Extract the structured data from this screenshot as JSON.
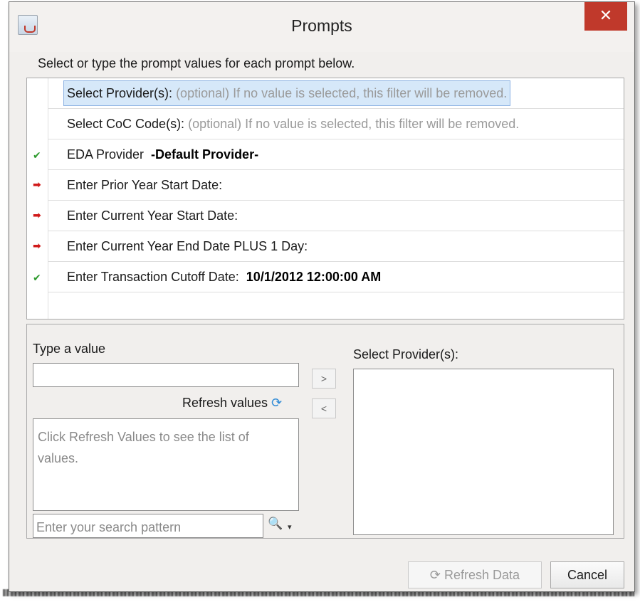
{
  "window": {
    "title": "Prompts",
    "close_glyph": "✕",
    "app_icon": "java-cup-icon"
  },
  "instructions": "Select or type the prompt values for each prompt below.",
  "prompts": [
    {
      "label": "Select Provider(s):",
      "hint": "(optional) If no value is selected, this filter will be removed.",
      "value": "",
      "status": "none",
      "selected": true
    },
    {
      "label": "Select CoC Code(s):",
      "hint": "(optional) If no value is selected, this filter will be removed.",
      "value": "",
      "status": "none",
      "selected": false
    },
    {
      "label": "EDA Provider",
      "hint": "",
      "value": "-Default Provider-",
      "status": "check",
      "selected": false
    },
    {
      "label": "Enter Prior Year Start Date:",
      "hint": "",
      "value": "",
      "status": "arrow",
      "selected": false
    },
    {
      "label": "Enter Current Year Start Date:",
      "hint": "",
      "value": "",
      "status": "arrow",
      "selected": false
    },
    {
      "label": "Enter Current Year End Date PLUS 1 Day:",
      "hint": "",
      "value": "",
      "status": "arrow",
      "selected": false
    },
    {
      "label": "Enter Transaction Cutoff Date:",
      "hint": "",
      "value": "10/1/2012 12:00:00 AM",
      "status": "check",
      "selected": false
    }
  ],
  "status_glyphs": {
    "check": "✔",
    "arrow": "➡"
  },
  "value_panel": {
    "type_label": "Type a value",
    "type_value": "",
    "refresh_values_label": "Refresh values",
    "refresh_glyph": "⟳",
    "list_placeholder": "Click Refresh Values to see the list of values.",
    "search_placeholder": "Enter your search pattern",
    "search_icon_glyph": "🔍",
    "dropdown_glyph": "▾",
    "add_glyph": ">",
    "remove_glyph": "<",
    "selected_label": "Select Provider(s):"
  },
  "footer": {
    "refresh_data_label": "Refresh Data",
    "refresh_data_glyph": "⟳",
    "cancel_label": "Cancel"
  },
  "colors": {
    "selection_bg": "#d6e8f9",
    "close_red": "#c0392b",
    "check_green": "#2d9a2d",
    "arrow_red": "#d01a1a"
  }
}
